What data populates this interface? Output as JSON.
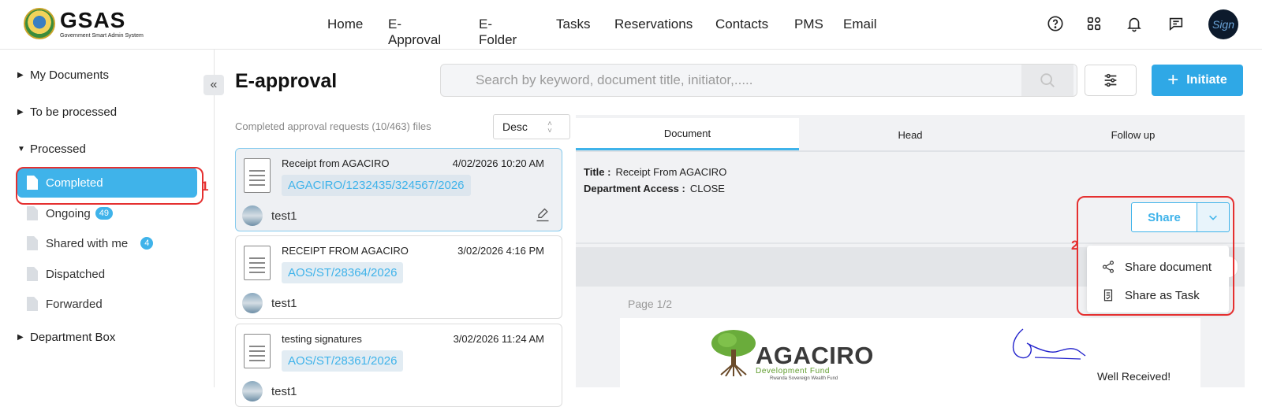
{
  "app": {
    "logo_title": "GSAS",
    "logo_subtitle": "Government Smart Admin System"
  },
  "nav": {
    "items": [
      "Home",
      "E-Approval",
      "E-Folder",
      "Tasks",
      "Reservations",
      "Contacts",
      "PMS",
      "Email"
    ]
  },
  "header_icons": [
    "help-icon",
    "apps-grid-icon",
    "bell-icon",
    "chat-icon"
  ],
  "user_avatar_text": "Sign",
  "sidebar": {
    "groups": {
      "my_documents": "My Documents",
      "to_be_processed": "To be processed",
      "processed": "Processed",
      "department_box": "Department Box"
    },
    "items": [
      {
        "label": "Completed",
        "badge": ""
      },
      {
        "label": "Ongoing",
        "badge": "49"
      },
      {
        "label": "Shared with me",
        "badge": "4"
      },
      {
        "label": "Dispatched",
        "badge": ""
      },
      {
        "label": "Forwarded",
        "badge": ""
      }
    ]
  },
  "annotations": {
    "one": "1",
    "two": "2"
  },
  "main": {
    "title": "E-approval",
    "search_placeholder": "Search by keyword, document title, initiator,.....",
    "initiate_label": "Initiate",
    "list_caption": "Completed approval requests (10/463) files",
    "sort_value": "Desc"
  },
  "cards": [
    {
      "title": "Receipt from AGACIRO",
      "date": "4/02/2026 10:20 AM",
      "ref": "AGACIRO/1232435/324567/2026",
      "user": "test1"
    },
    {
      "title": "RECEIPT FROM AGACIRO",
      "date": "3/02/2026 4:16 PM",
      "ref": "AOS/ST/28364/2026",
      "user": "test1"
    },
    {
      "title": "testing signatures",
      "date": "3/02/2026 11:24 AM",
      "ref": "AOS/ST/28361/2026",
      "user": "test1"
    }
  ],
  "tabs": [
    "Document",
    "Head",
    "Follow up"
  ],
  "detail": {
    "title_label": "Title :",
    "title_value": "Receipt From AGACIRO",
    "access_label": "Department Access :",
    "access_value": "CLOSE",
    "share_label": "Share",
    "menu": [
      "Share document",
      "Share as Task"
    ],
    "page_info": "Page 1/2",
    "doc_brand": "AGACIRO",
    "doc_brand_sub": "Development Fund",
    "doc_brand_sub2": "Rwanda Sovereign Wealth Fund",
    "doc_note": "Well Received!"
  },
  "colors": {
    "accent": "#3fb3ea",
    "annotation": "#e53030",
    "panel_bg": "#f1f2f4"
  }
}
